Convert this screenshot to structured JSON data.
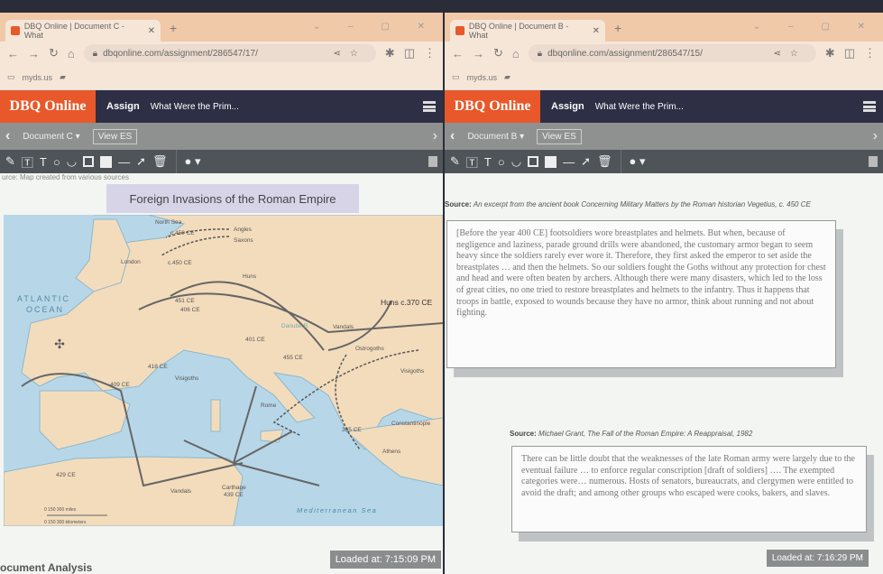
{
  "left": {
    "tab_title": "DBQ Online | Document C - What",
    "url": "dbqonline.com/assignment/286547/17/",
    "bookmark": "myds.us",
    "brand": "DBQ Online",
    "assign": "Assign",
    "title": "What Were the Prim...",
    "document": "Document C ▾",
    "view_es": "View ES",
    "source": "urce: Map created from various sources",
    "map_title": "Foreign Invasions of the Roman Empire",
    "map_labels": {
      "north_sea": "North Sea",
      "angles": "Angles",
      "saxons": "Saxons",
      "london": "London",
      "c450a": "c.450 CE",
      "c450b": "c.450 CE",
      "huns": "Huns",
      "atlantic": "ATLANTIC",
      "ocean": "OCEAN",
      "d451": "451 CE",
      "d406": "406 CE",
      "danube": "Danube R.",
      "vandals1": "Vandals",
      "huns370": "Huns c.370 CE",
      "d401": "401 CE",
      "ostrogoths": "Ostrogoths",
      "d455": "455 CE",
      "visigoths": "Visigoths",
      "visigoths2": "Visigoths",
      "d409": "409 CE",
      "d418": "418 CE",
      "rome": "Rome",
      "constantinople": "Constantinople",
      "athens": "Athens",
      "d395": "395 CE",
      "d429": "429 CE",
      "vandals2": "Vandals",
      "carthage": "Carthage",
      "d439": "439 CE",
      "med": "Mediterranean Sea",
      "scale_miles": "0      150      300 miles",
      "scale_km": "0    150    300 kilometers"
    },
    "loaded": "Loaded at: 7:15:09 PM",
    "analysis": "ocument Analysis"
  },
  "right": {
    "tab_title": "DBQ Online | Document B - What",
    "url": "dbqonline.com/assignment/286547/15/",
    "bookmark": "myds.us",
    "brand": "DBQ Online",
    "assign": "Assign",
    "title": "What Were the Prim...",
    "document": "Document B ▾",
    "view_es": "View ES",
    "source1_label": "Source:",
    "source1": "An excerpt from the ancient book Concerning Military Matters by the Roman historian Vegetius, c. 450 CE",
    "quote1": "[Before the year 400 CE] footsoldiers wore breastplates and helmets. But when, because of negligence and laziness, parade ground drills were abandoned, the customary armor began to seem heavy since the soldiers rarely ever wore it. Therefore, they first asked the emperor to set aside the breastplates … and then the helmets. So our soldiers fought the Goths without any protection for chest and head and were often beaten by archers. Although there were many disasters, which led to the loss of great cities, no one tried to restore breastplates and helmets to the infantry. Thus it happens that troops in battle, exposed to wounds because they have no armor, think about running and not about fighting.",
    "source2_label": "Source:",
    "source2": "Michael Grant, The Fall of the Roman Empire: A Reappraisal, 1982",
    "quote2": "There can be little doubt that the weaknesses of the late Roman army were largely due to the eventual failure … to enforce regular conscription [draft of soldiers] …. The exempted categories were… numerous. Hosts of senators, bureaucrats, and clergymen were entitled to avoid the draft; and among other groups who escaped were cooks, bakers, and slaves.",
    "loaded": "Loaded at: 7:16:29 PM"
  },
  "colors": {
    "brand": "#e8582a",
    "nav": "#2e2f45",
    "land": "#f3dcbc",
    "sea": "#b7d7e8"
  }
}
